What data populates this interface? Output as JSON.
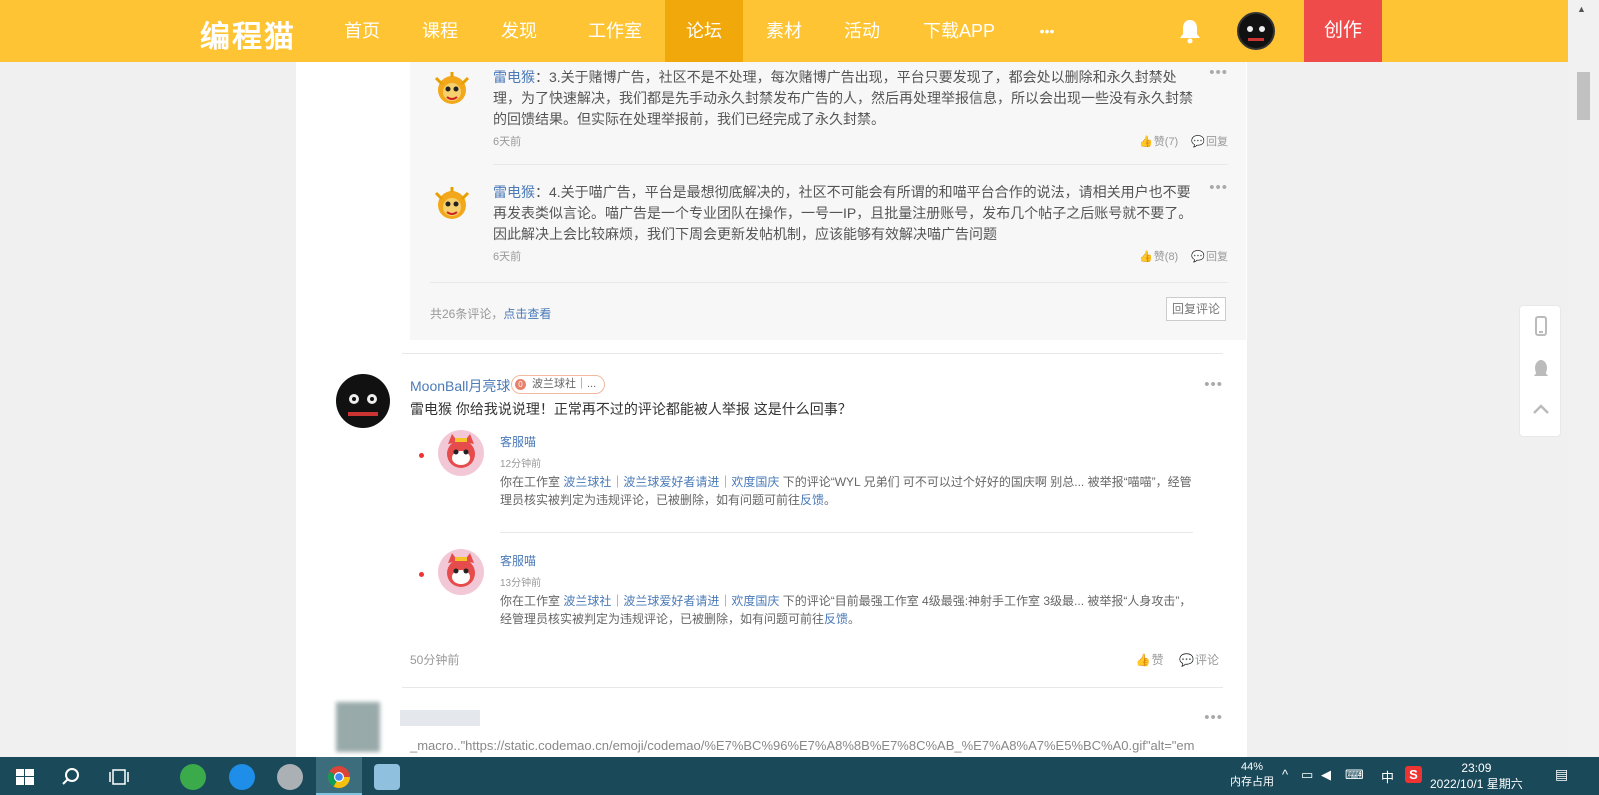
{
  "nav": {
    "logo": "编程猫",
    "items": [
      "首页",
      "课程",
      "发现",
      "工作室",
      "论坛",
      "素材",
      "活动",
      "下载APP",
      "•••"
    ],
    "active": "论坛",
    "create_label": "创作",
    "colors": {
      "bar": "#fec433",
      "active": "#f0a80a",
      "create": "#ef4b4b"
    }
  },
  "replies": [
    {
      "name": "雷电猴",
      "text": "：3.关于赌博广告，社区不是不处理，每次赌博广告出现，平台只要发现了，都会处以删除和永久封禁处理，为了快速解决，我们都是先手动永久封禁发布广告的人，然后再处理举报信息，所以会出现一些没有永久封禁的回馈结果。但实际在处理举报前，我们已经完成了永久封禁。",
      "time": "6天前",
      "like": "赞(7)",
      "reply": "回复"
    },
    {
      "name": "雷电猴",
      "text": "：4.关于喵广告，平台是最想彻底解决的，社区不可能会有所谓的和喵平台合作的说法，请相关用户也不要再发表类似言论。喵广告是一个专业团队在操作，一号一IP，且批量注册账号，发布几个帖子之后账号就不要了。因此解决上会比较麻烦，我们下周会更新发帖机制，应该能够有效解决喵广告问题",
      "time": "6天前",
      "like": "赞(8)",
      "reply": "回复"
    }
  ],
  "summary": {
    "count": "共26条评论，",
    "link": "点击查看",
    "reply_btn": "回复评论"
  },
  "comment": {
    "user": "MoonBall月亮球",
    "badge_dot": "0",
    "badge": "波兰球社｜...",
    "text": "雷电猴 你给我说说理！正常再不过的评论都能被人举报 这是什么回事？",
    "time": "50分钟前",
    "like": "赞",
    "comment": "评论",
    "notices": [
      {
        "name": "客服喵",
        "time": "12分钟前",
        "pre": "你在工作室 ",
        "studio": "波兰球社｜波兰球爱好者请进｜欢度国庆",
        "mid": " 下的评论“WYL 兄弟们 可不可以过个好好的国庆啊 别总...  被举报“喵喵”，经管理员核实被判定为违规评论，已被删除，如有问题可前往",
        "link": "反馈",
        "end": "。"
      },
      {
        "name": "客服喵",
        "time": "13分钟前",
        "pre": "你在工作室 ",
        "studio": "波兰球社｜波兰球爱好者请进｜欢度国庆",
        "mid": " 下的评论“目前最强工作室 4级最强:神射手工作室 3级最...  被举报“人身攻击”，经管理员核实被判定为违规评论，已被删除，如有问题可前往",
        "link": "反馈",
        "end": "。"
      }
    ]
  },
  "next_comment_text": "_macro..\"https://static.codemao.cn/emoji/codemao/%E7%BC%96%E7%A8%8B%E7%8C%AB_%E7%A8%A7%E5%BC%A0.gif\"alt=\"em",
  "taskbar": {
    "mem_pct": "44%",
    "mem_label": "内存占用",
    "ime": "中",
    "time": "23:09",
    "date": "2022/10/1 星期六"
  }
}
